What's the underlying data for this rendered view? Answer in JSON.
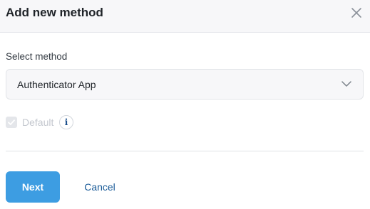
{
  "dialog": {
    "title": "Add new method",
    "close_icon": "close-icon"
  },
  "method_select": {
    "label": "Select method",
    "selected_value": "Authenticator App",
    "icon": "chevron-down-icon"
  },
  "default_option": {
    "label": "Default",
    "checked": true,
    "disabled": true,
    "info_icon": "info-icon",
    "info_glyph": "i"
  },
  "actions": {
    "next_label": "Next",
    "cancel_label": "Cancel"
  },
  "colors": {
    "primary": "#3d9de2",
    "link": "#1b5c99",
    "header_bg": "#f7f7f9"
  }
}
